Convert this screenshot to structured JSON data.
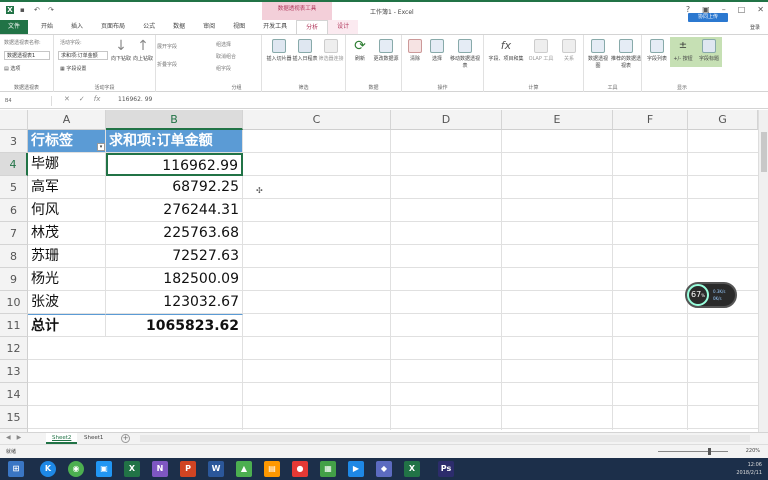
{
  "window": {
    "title": "工作簿1 - Excel",
    "context_tool_title": "数据透视表工具",
    "share_label": "协同上传",
    "login_label": "登录"
  },
  "tabs": [
    {
      "label": "文件"
    },
    {
      "label": "开始"
    },
    {
      "label": "插入"
    },
    {
      "label": "页面布局"
    },
    {
      "label": "公式"
    },
    {
      "label": "数据"
    },
    {
      "label": "审阅"
    },
    {
      "label": "视图"
    },
    {
      "label": "开发工具"
    },
    {
      "label": "分析"
    },
    {
      "label": "设计"
    }
  ],
  "ribbon": {
    "pivot_name_label": "数据透视表名称:",
    "pivot_name_value": "数据透视表1",
    "options_label": "选项",
    "active_field_label": "活动字段:",
    "active_field_value": "求和项:订单金额",
    "field_settings_label": "字段设置",
    "drill_down_label": "向下钻取",
    "drill_up_label": "向上钻取",
    "expand_field_label": "展开字段",
    "collapse_field_label": "折叠字段",
    "group_selection_label": "组选择",
    "ungroup_label": "取消组合",
    "group_field_label": "组字段",
    "insert_slicer_label": "插入切片器",
    "insert_timeline_label": "插入日程表",
    "filter_connections_label": "筛选器连接",
    "refresh_label": "刷新",
    "change_source_label": "更改数据源",
    "clear_label": "清除",
    "select_label": "选择",
    "move_pivot_label": "移动数据透视表",
    "fields_items_label": "字段、项目和集",
    "olap_tools_label": "OLAP 工具",
    "relationships_label": "关系",
    "pivot_chart_label": "数据透视图",
    "recommended_label": "推荐的数据透视表",
    "field_list_label": "字段列表",
    "buttons_label": "+/- 按钮",
    "field_headers_label": "字段标题",
    "group_labels": [
      "数据透视表",
      "活动字段",
      "分组",
      "筛选",
      "数据",
      "操作",
      "计算",
      "工具",
      "显示"
    ]
  },
  "formula_bar": {
    "name_box": "B4",
    "value": "116962. 99"
  },
  "grid": {
    "columns": [
      "A",
      "B",
      "C",
      "D",
      "E",
      "F",
      "G"
    ],
    "rows": [
      "3",
      "4",
      "5",
      "6",
      "7",
      "8",
      "9",
      "10",
      "11",
      "12",
      "13",
      "14",
      "15",
      "16",
      "17",
      "18"
    ],
    "header": {
      "label": "行标签",
      "value": "求和项:订单金额"
    },
    "records": [
      {
        "name": "毕娜",
        "amount": "116962.99"
      },
      {
        "name": "高军",
        "amount": "68792.25"
      },
      {
        "name": "何风",
        "amount": "276244.31"
      },
      {
        "name": "林茂",
        "amount": "225763.68"
      },
      {
        "name": "苏珊",
        "amount": "72527.63"
      },
      {
        "name": "杨光",
        "amount": "182500.09"
      },
      {
        "name": "张波",
        "amount": "123032.67"
      }
    ],
    "total": {
      "label": "总计",
      "value": "1065823.62"
    }
  },
  "sheets": [
    {
      "label": "Sheet2"
    },
    {
      "label": "Sheet1"
    }
  ],
  "status": {
    "ready": "就绪",
    "zoom": "220%"
  },
  "net_widget": {
    "percent": "67",
    "up": "0.3K/s",
    "down": "0K/s"
  },
  "taskbar": {
    "time": "12:06",
    "date": "2018/2/11"
  },
  "colors": {
    "excel_green": "#217346",
    "pivot_header": "#5b9bd5",
    "context_pink": "#b0365a"
  }
}
